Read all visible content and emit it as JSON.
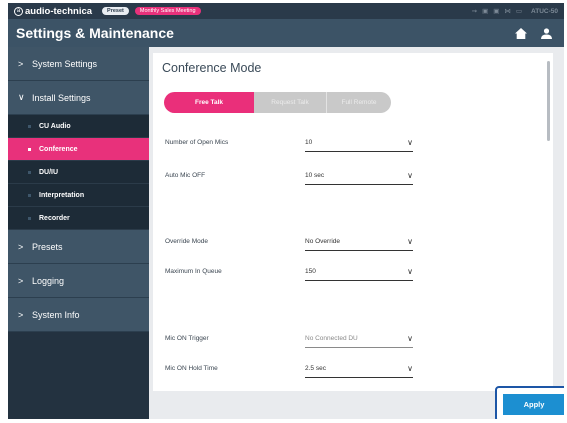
{
  "topbar": {
    "brand": "audio-technica",
    "brand_mark": "a",
    "preset_badge": "Preset",
    "meeting_badge": "Monthly Sales Meeting",
    "model": "ATUC-50",
    "status_icons": [
      "usb-icon",
      "status-icon",
      "status-icon",
      "network-icon",
      "monitor-icon"
    ]
  },
  "header": {
    "title": "Settings & Maintenance",
    "icons": [
      "home-icon",
      "user-icon"
    ]
  },
  "sidebar": {
    "items": [
      {
        "label": "System Settings",
        "chevron": ">"
      },
      {
        "label": "Install Settings",
        "chevron": "∨"
      }
    ],
    "sub_items": [
      {
        "label": "CU Audio"
      },
      {
        "label": "Conference",
        "active": true
      },
      {
        "label": "DU/IU"
      },
      {
        "label": "Interpretation"
      },
      {
        "label": "Recorder"
      }
    ],
    "bottom_items": [
      {
        "label": "Presets",
        "chevron": ">"
      },
      {
        "label": "Logging",
        "chevron": ">"
      },
      {
        "label": "System Info",
        "chevron": ">"
      }
    ]
  },
  "main": {
    "title": "Conference Mode",
    "modes": [
      "Free Talk",
      "Request Talk",
      "Full Remote"
    ],
    "active_mode": "Free Talk",
    "fields": [
      {
        "label": "Number of Open Mics",
        "value": "10"
      },
      {
        "label": "Auto Mic OFF",
        "value": "10 sec"
      },
      {
        "label": "Override Mode",
        "value": "No Override"
      },
      {
        "label": "Maximum In Queue",
        "value": "150"
      },
      {
        "label": "Mic ON Trigger",
        "value": "No Connected DU"
      },
      {
        "label": "Mic ON Hold Time",
        "value": "2.5 sec"
      }
    ],
    "apply_label": "Apply"
  },
  "colors": {
    "accent": "#e8317b",
    "header": "#3c5366",
    "sidebar": "#233240",
    "apply": "#1c8fd1",
    "highlight": "#1d56a6"
  }
}
